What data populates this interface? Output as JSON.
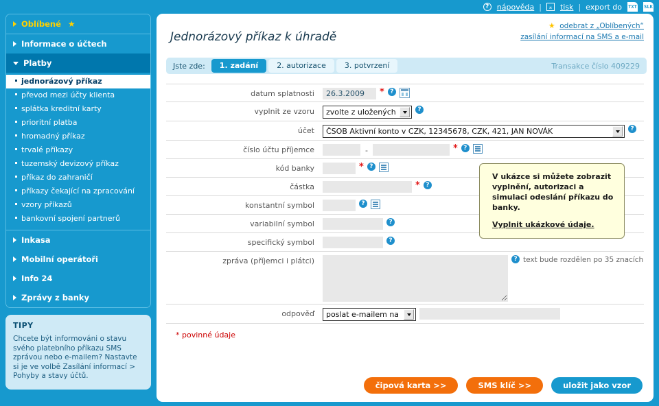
{
  "topbar": {
    "help_icon": "question-circle-icon",
    "help_label": "nápověda",
    "print_icon": "print-icon",
    "print_label": "tisk",
    "export_label": "export do",
    "export_txt": "TXT",
    "export_slk": "SLK",
    "separator": "|"
  },
  "sidebar": {
    "sections": [
      {
        "label": "Oblíbené",
        "state": "collapsed",
        "favorite": true,
        "star": "★"
      },
      {
        "label": "Informace o účtech",
        "state": "collapsed",
        "favorite": false
      },
      {
        "label": "Platby",
        "state": "expanded",
        "favorite": false
      }
    ],
    "payments_items": [
      {
        "label": "jednorázový příkaz",
        "active": true
      },
      {
        "label": "převod mezi účty klienta",
        "active": false
      },
      {
        "label": "splátka kreditní karty",
        "active": false
      },
      {
        "label": "prioritní platba",
        "active": false
      },
      {
        "label": "hromadný příkaz",
        "active": false
      },
      {
        "label": "trvalé příkazy",
        "active": false
      },
      {
        "label": "tuzemský devizový příkaz",
        "active": false
      },
      {
        "label": "příkaz do zahraničí",
        "active": false
      },
      {
        "label": "příkazy čekající na zpracování",
        "active": false
      },
      {
        "label": "vzory příkazů",
        "active": false
      },
      {
        "label": "bankovní spojení partnerů",
        "active": false
      }
    ],
    "sections_bottom": [
      {
        "label": "Inkasa"
      },
      {
        "label": "Mobilní operátoři"
      },
      {
        "label": "Info 24"
      },
      {
        "label": "Zprávy z banky"
      }
    ],
    "tips": {
      "heading": "TIPY",
      "body": "Chcete být informováni o stavu svého platebního příkazu SMS zprávou nebo e-mailem? Nastavte si je ve volbě Zasílání informací > Pohyby a stavy účtů."
    }
  },
  "panel": {
    "title": "Jednorázový příkaz k úhradě",
    "links": {
      "favorite_remove": "odebrat z „Oblíbených“",
      "sms_email": "zasílání informací na SMS a e-mail"
    },
    "tabs": {
      "you_are_here": "Jste zde:",
      "items": [
        {
          "label": "1. zadání",
          "active": true
        },
        {
          "label": "2. autorizace",
          "active": false
        },
        {
          "label": "3. potvrzení",
          "active": false
        }
      ],
      "transaction": "Transakce číslo 409229"
    }
  },
  "form": {
    "rows": {
      "due_date": {
        "label": "datum splatnosti",
        "value": "26.3.2009",
        "required": true,
        "calendar_icon": "calendar-icon"
      },
      "template": {
        "label": "vyplnit ze vzoru",
        "value": "zvolte z uložených",
        "required": false
      },
      "account": {
        "label": "účet",
        "value": "ČSOB Aktivní konto v CZK, 12345678, CZK, 421, JAN NOVÁK",
        "required": false
      },
      "recipient_account": {
        "label": "číslo účtu příjemce",
        "prefix": "",
        "number": "",
        "separator": "-",
        "required": true
      },
      "bank_code": {
        "label": "kód banky",
        "value": "",
        "required": true
      },
      "amount": {
        "label": "částka",
        "value": "",
        "required": true
      },
      "constant_symbol": {
        "label": "konstantní symbol",
        "value": "",
        "required": false
      },
      "variable_symbol": {
        "label": "variabilní symbol",
        "value": "",
        "required": false
      },
      "specific_symbol": {
        "label": "specifický symbol",
        "value": "",
        "required": false
      },
      "message": {
        "label": "zpráva (příjemci i plátci)",
        "value": "",
        "hint": "text bude rozdělen po 35 znacích"
      },
      "reply": {
        "label": "odpověď",
        "value": "poslat e-mailem na",
        "email": ""
      }
    },
    "required_note": "* povinné údaje",
    "required_marker": "*",
    "help_marker": "?"
  },
  "callout": {
    "text": "V ukázce si můžete zobrazit vyplnění, autorizaci a simulaci odeslání příkazu do banky.",
    "link": "Vyplnit ukázkové údaje."
  },
  "buttons": {
    "chip_card": "čipová karta >>",
    "sms_key": "SMS klíč >>",
    "save_template": "uložit jako vzor"
  },
  "colors": {
    "brand_blue": "#1799CE",
    "dark_blue": "#0077AD",
    "orange": "#F36F0B",
    "yellow_star": "#FFD100",
    "required_red": "#E21A1A",
    "callout_bg": "#FFFFDE"
  }
}
